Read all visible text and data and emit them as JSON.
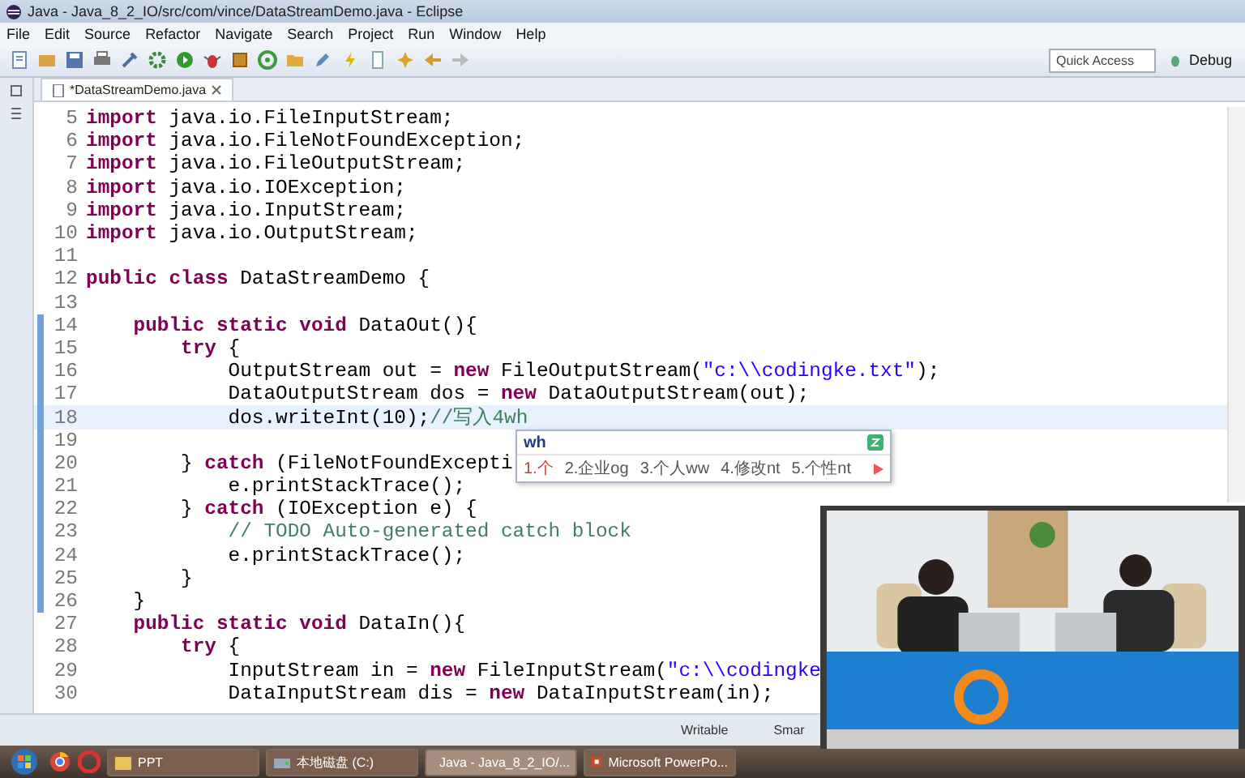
{
  "window": {
    "title": "Java - Java_8_2_IO/src/com/vince/DataStreamDemo.java - Eclipse"
  },
  "menu": [
    "File",
    "Edit",
    "Source",
    "Refactor",
    "Navigate",
    "Search",
    "Project",
    "Run",
    "Window",
    "Help"
  ],
  "toolbar": {
    "quick_access": {
      "placeholder": "Quick Access"
    },
    "perspective": "Debug"
  },
  "editor_tab": {
    "title": "*DataStreamDemo.java"
  },
  "code": [
    {
      "number": "5",
      "marked": false,
      "current": false,
      "segments": [
        {
          "text": "import",
          "kind": "keyword"
        },
        {
          "text": " java.io.FileInputStream;",
          "kind": "plain"
        }
      ]
    },
    {
      "number": "6",
      "marked": false,
      "current": false,
      "segments": [
        {
          "text": "import",
          "kind": "keyword"
        },
        {
          "text": " java.io.FileNotFoundException;",
          "kind": "plain"
        }
      ]
    },
    {
      "number": "7",
      "marked": false,
      "current": false,
      "segments": [
        {
          "text": "import",
          "kind": "keyword"
        },
        {
          "text": " java.io.FileOutputStream;",
          "kind": "plain"
        }
      ]
    },
    {
      "number": "8",
      "marked": false,
      "current": false,
      "segments": [
        {
          "text": "import",
          "kind": "keyword"
        },
        {
          "text": " java.io.IOException;",
          "kind": "plain"
        }
      ]
    },
    {
      "number": "9",
      "marked": false,
      "current": false,
      "segments": [
        {
          "text": "import",
          "kind": "keyword"
        },
        {
          "text": " java.io.InputStream;",
          "kind": "plain"
        }
      ]
    },
    {
      "number": "10",
      "marked": false,
      "current": false,
      "segments": [
        {
          "text": "import",
          "kind": "keyword"
        },
        {
          "text": " java.io.OutputStream;",
          "kind": "plain"
        }
      ]
    },
    {
      "number": "11",
      "marked": false,
      "current": false
    },
    {
      "number": "12",
      "marked": false,
      "current": false,
      "segments": [
        {
          "text": "public class",
          "kind": "keyword"
        },
        {
          "text": " DataStreamDemo {",
          "kind": "plain"
        }
      ]
    },
    {
      "number": "13",
      "marked": false,
      "current": false
    },
    {
      "number": "14",
      "marked": true,
      "current": false,
      "segments": [
        {
          "text": "    public static void",
          "kind": "keyword"
        },
        {
          "text": " DataOut(){",
          "kind": "plain"
        }
      ]
    },
    {
      "number": "15",
      "marked": true,
      "current": false,
      "segments": [
        {
          "text": "        try",
          "kind": "keyword"
        },
        {
          "text": " {",
          "kind": "plain"
        }
      ]
    },
    {
      "number": "16",
      "marked": true,
      "current": false,
      "segments": [
        {
          "text": "            OutputStream out = ",
          "kind": "plain"
        },
        {
          "text": "new",
          "kind": "keyword"
        },
        {
          "text": " FileOutputStream(",
          "kind": "plain"
        },
        {
          "text": "\"c:\\\\codingke.txt\"",
          "kind": "string"
        },
        {
          "text": ");",
          "kind": "plain"
        }
      ]
    },
    {
      "number": "17",
      "marked": true,
      "current": false,
      "segments": [
        {
          "text": "            DataOutputStream dos = ",
          "kind": "plain"
        },
        {
          "text": "new",
          "kind": "keyword"
        },
        {
          "text": " DataOutputStream(out);",
          "kind": "plain"
        }
      ]
    },
    {
      "number": "18",
      "marked": true,
      "current": true,
      "segments": [
        {
          "text": "            dos.writeInt(10);",
          "kind": "plain"
        },
        {
          "text": "//写入4wh",
          "kind": "comment"
        }
      ]
    },
    {
      "number": "19",
      "marked": true,
      "current": false
    },
    {
      "number": "20",
      "marked": true,
      "current": false,
      "segments": [
        {
          "text": "        } ",
          "kind": "plain"
        },
        {
          "text": "catch",
          "kind": "keyword"
        },
        {
          "text": " (FileNotFoundExcepti",
          "kind": "plain"
        }
      ]
    },
    {
      "number": "21",
      "marked": true,
      "current": false,
      "segments": [
        {
          "text": "            e.printStackTrace();",
          "kind": "plain"
        }
      ]
    },
    {
      "number": "22",
      "marked": true,
      "current": false,
      "segments": [
        {
          "text": "        } ",
          "kind": "plain"
        },
        {
          "text": "catch",
          "kind": "keyword"
        },
        {
          "text": " (IOException e) {",
          "kind": "plain"
        }
      ]
    },
    {
      "number": "23",
      "marked": true,
      "current": false,
      "segments": [
        {
          "text": "            // TODO Auto-generated catch block",
          "kind": "comment"
        }
      ]
    },
    {
      "number": "24",
      "marked": true,
      "current": false,
      "segments": [
        {
          "text": "            e.printStackTrace();",
          "kind": "plain"
        }
      ]
    },
    {
      "number": "25",
      "marked": true,
      "current": false,
      "segments": [
        {
          "text": "        }",
          "kind": "plain"
        }
      ]
    },
    {
      "number": "26",
      "marked": true,
      "current": false,
      "segments": [
        {
          "text": "    }",
          "kind": "plain"
        }
      ]
    },
    {
      "number": "27",
      "marked": false,
      "current": false,
      "segments": [
        {
          "text": "    public static void",
          "kind": "keyword"
        },
        {
          "text": " DataIn(){",
          "kind": "plain"
        }
      ]
    },
    {
      "number": "28",
      "marked": false,
      "current": false,
      "segments": [
        {
          "text": "        try",
          "kind": "keyword"
        },
        {
          "text": " {",
          "kind": "plain"
        }
      ]
    },
    {
      "number": "29",
      "marked": false,
      "current": false,
      "segments": [
        {
          "text": "            InputStream in = ",
          "kind": "plain"
        },
        {
          "text": "new",
          "kind": "keyword"
        },
        {
          "text": " FileInputStream(",
          "kind": "plain"
        },
        {
          "text": "\"c:\\\\codingke",
          "kind": "string"
        }
      ]
    },
    {
      "number": "30",
      "marked": false,
      "current": false,
      "segments": [
        {
          "text": "            DataInputStream dis = ",
          "kind": "plain"
        },
        {
          "text": "new",
          "kind": "keyword"
        },
        {
          "text": " DataInputStream(in);",
          "kind": "plain"
        }
      ]
    }
  ],
  "ime": {
    "input": "wh",
    "candidates": [
      {
        "label": "1.个",
        "selected": true
      },
      {
        "label": "2.企业og",
        "selected": false
      },
      {
        "label": "3.个人ww",
        "selected": false
      },
      {
        "label": "4.修改nt",
        "selected": false
      },
      {
        "label": "5.个性nt",
        "selected": false
      }
    ]
  },
  "status_bar": [
    "Writable",
    "Smar"
  ],
  "taskbar": [
    {
      "label": "PPT",
      "kind": "folder",
      "selected": false
    },
    {
      "label": "本地磁盘 (C:)",
      "kind": "drive",
      "selected": false
    },
    {
      "label": "Java - Java_8_2_IO/...",
      "kind": "eclipse",
      "selected": true
    },
    {
      "label": "Microsoft PowerPo...",
      "kind": "powerpoint",
      "selected": false
    }
  ],
  "video": {
    "kind": "picture"
  }
}
